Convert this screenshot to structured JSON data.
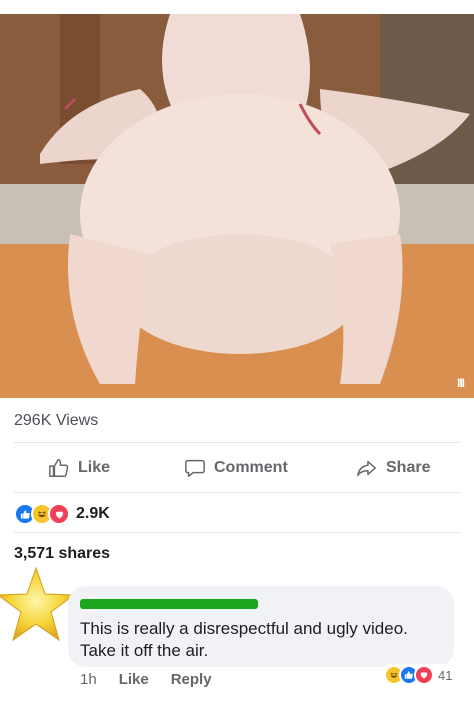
{
  "video": {
    "menu_glyph": "III"
  },
  "post": {
    "views": "296K Views",
    "actions": {
      "like": "Like",
      "comment": "Comment",
      "share": "Share"
    },
    "reactions": {
      "icons": [
        "like-icon",
        "haha-icon",
        "love-icon"
      ],
      "count": "2.9K"
    },
    "shares": "3,571 shares"
  },
  "comment": {
    "text": "This is really a disrespectful and ugly video. Take it off the air.",
    "time": "1h",
    "like_label": "Like",
    "reply_label": "Reply",
    "reaction_icons": [
      "haha-icon",
      "like-icon",
      "love-icon"
    ],
    "reaction_count": "41",
    "name_redaction_color": "#1aa51a"
  },
  "colors": {
    "like_blue": "#1877f2",
    "love_red": "#f33e58",
    "haha_yellow": "#f7c52b",
    "muted_text": "#65676b"
  }
}
